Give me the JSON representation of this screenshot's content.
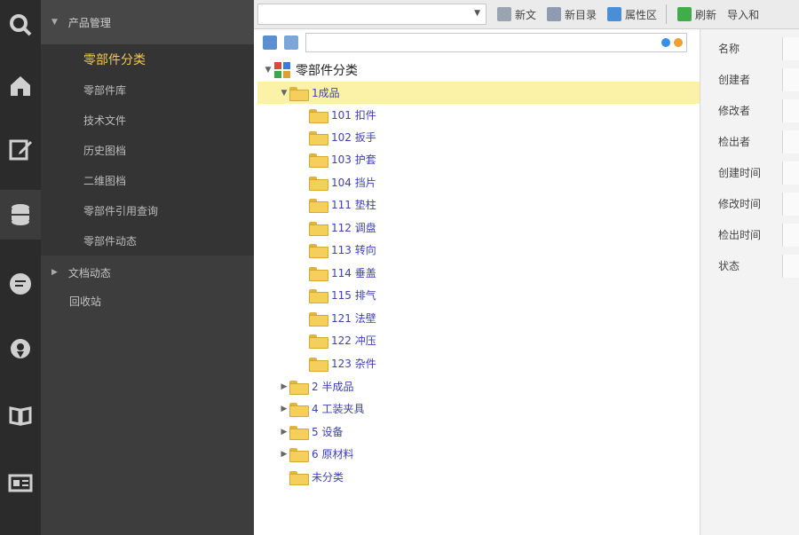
{
  "rail": [
    {
      "icon": "search-icon"
    },
    {
      "icon": "home-icon"
    },
    {
      "icon": "edit-icon"
    },
    {
      "icon": "database-icon",
      "active": true
    },
    {
      "icon": "chat-icon"
    },
    {
      "icon": "location-icon"
    },
    {
      "icon": "book-icon"
    },
    {
      "icon": "id-card-icon"
    }
  ],
  "nav": {
    "section_title": "产品管理",
    "items": [
      "零部件分类",
      "零部件库",
      "技术文件",
      "历史图档",
      "二维图档",
      "零部件引用查询",
      "零部件动态"
    ],
    "active_index": 0,
    "group2": "文档动态",
    "plain": "回收站"
  },
  "toolbar": {
    "buttons": [
      "新文",
      "新目录",
      "属性区"
    ],
    "buttons_right": [
      "刷新",
      "导入和"
    ]
  },
  "tree": {
    "root": "零部件分类",
    "nodes": [
      {
        "label": "1成品",
        "expanded": true,
        "selected": true
      },
      {
        "label": "101 扣件"
      },
      {
        "label": "102 扳手"
      },
      {
        "label": "103 护套"
      },
      {
        "label": "104 挡片"
      },
      {
        "label": "111 垫柱"
      },
      {
        "label": "112 调盘"
      },
      {
        "label": "113 转向"
      },
      {
        "label": "114 垂盖"
      },
      {
        "label": "115 排气"
      },
      {
        "label": "121 法壁"
      },
      {
        "label": "122 冲压"
      },
      {
        "label": "123 杂件"
      },
      {
        "label": "2 半成品",
        "collapsed": true
      },
      {
        "label": "4 工装夹具",
        "collapsed": true
      },
      {
        "label": "5 设备",
        "collapsed": true
      },
      {
        "label": "6 原材料",
        "collapsed": true
      },
      {
        "label": "未分类"
      }
    ]
  },
  "props": {
    "labels": [
      "名称",
      "创建者",
      "修改者",
      "检出者",
      "创建时间",
      "修改时间",
      "检出时间",
      "状态"
    ]
  }
}
